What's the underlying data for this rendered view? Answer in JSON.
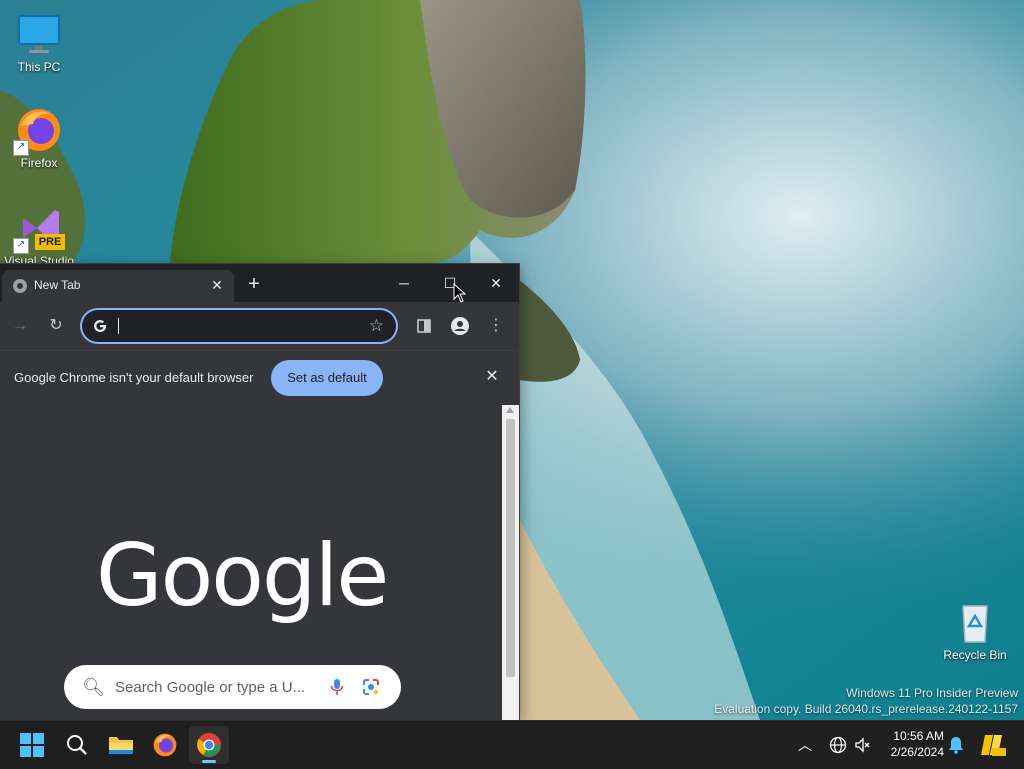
{
  "desktop": {
    "icons": [
      {
        "label": "This PC"
      },
      {
        "label": "Firefox"
      },
      {
        "label": "Visual Studio",
        "badge": "PRE"
      },
      {
        "label": "Recycle Bin"
      }
    ],
    "watermark": {
      "line1": "Windows 11 Pro Insider Preview",
      "line2": "Evaluation copy. Build 26040.rs_prerelease.240122-1157"
    }
  },
  "browser": {
    "tab": {
      "title": "New Tab"
    },
    "omnibox": {
      "value": ""
    },
    "infobar": {
      "message": "Google Chrome isn't your default browser",
      "button": "Set as default"
    },
    "newtab_page": {
      "logo": "Google",
      "search_placeholder": "Search Google or type a U..."
    }
  },
  "taskbar": {
    "clock": {
      "time": "10:56 AM",
      "date": "2/26/2024"
    }
  },
  "colors": {
    "accent": "#8ab4f8",
    "chrome_dark": "#202124",
    "chrome_toolbar": "#35363a",
    "taskbar": "#1f1f1f"
  }
}
